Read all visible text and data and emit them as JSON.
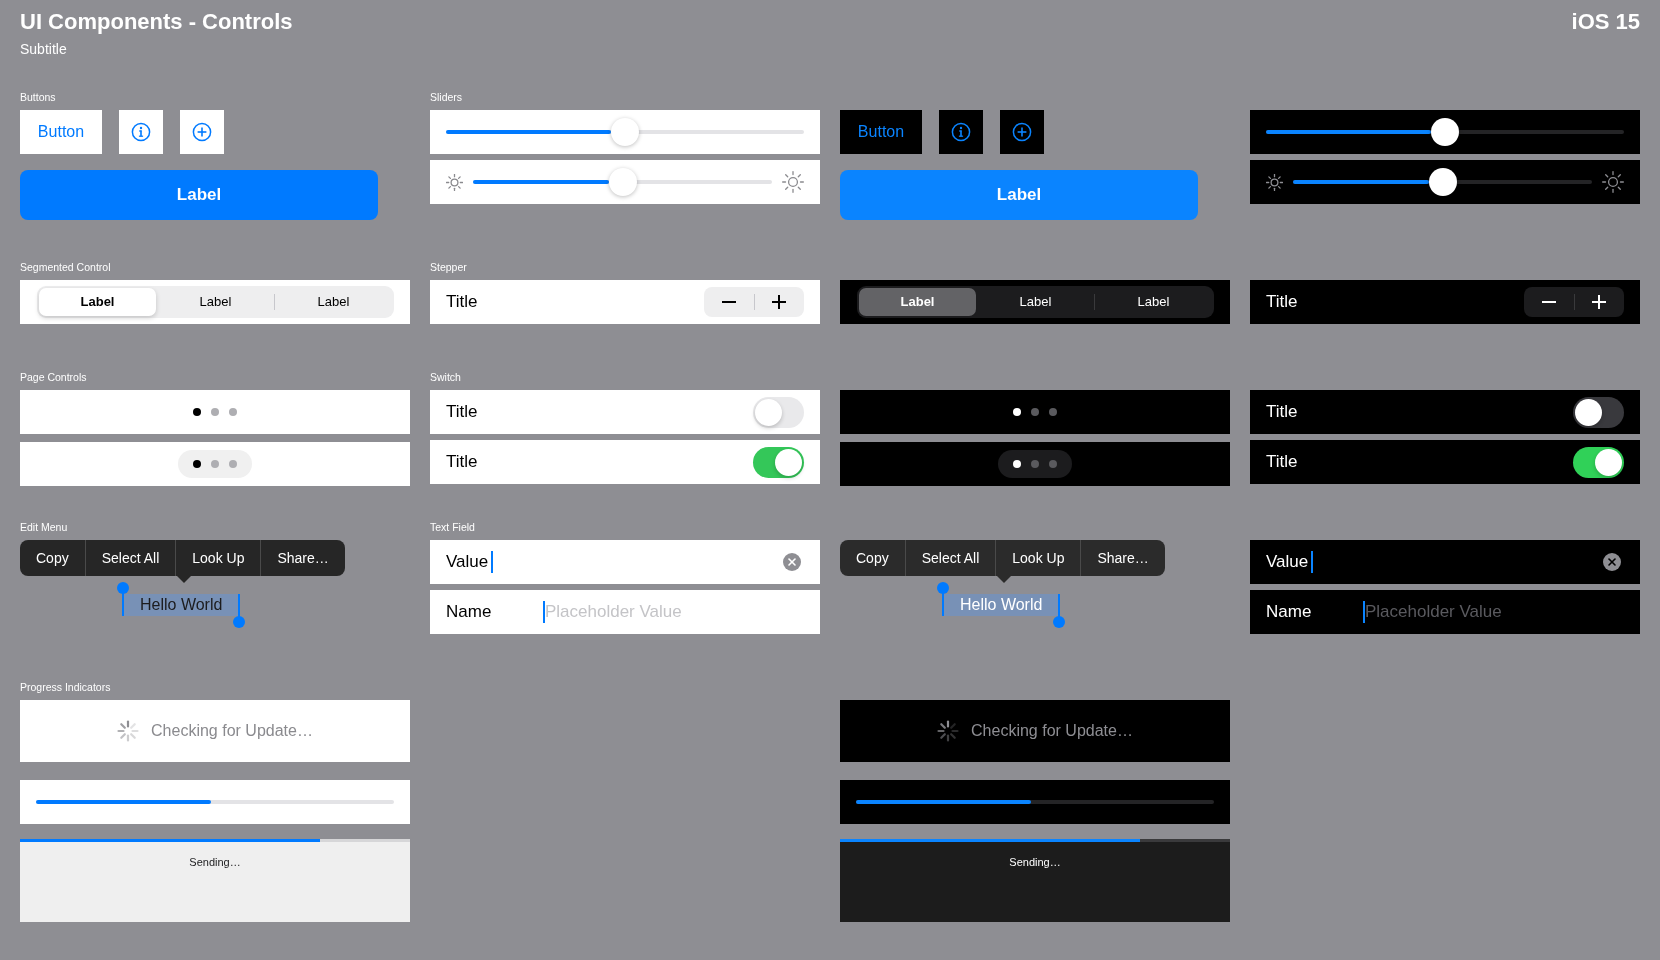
{
  "header": {
    "title": "UI Components - Controls",
    "subtitle": "Subtitle",
    "version": "iOS 15"
  },
  "themes": [
    {
      "kind": "light",
      "sections": [
        {
          "kind": "buttons",
          "label": "Buttons",
          "button": "Button",
          "primary_button": "Label"
        },
        {
          "kind": "sliders",
          "label": "Sliders",
          "sliders": [
            {
              "kind": "plain",
              "level": 0.5
            },
            {
              "kind": "brightness",
              "level": 0.5
            }
          ]
        },
        {
          "kind": "segmented_control",
          "label": "Segmented Control",
          "segments": [
            {
              "label": "Label",
              "selected": true
            },
            {
              "label": "Label",
              "selected": false
            },
            {
              "label": "Label",
              "selected": false
            }
          ]
        },
        {
          "kind": "stepper",
          "label": "Stepper",
          "title": "Title"
        },
        {
          "kind": "page_controls",
          "label": "Page Controls",
          "controls": [
            {
              "kind": "plain",
              "dots": [
                {
                  "selected": true
                },
                {
                  "selected": false
                },
                {
                  "selected": false
                }
              ]
            },
            {
              "kind": "capsule",
              "dots": [
                {
                  "selected": true
                },
                {
                  "selected": false
                },
                {
                  "selected": false
                }
              ]
            }
          ]
        },
        {
          "kind": "switches",
          "label": "Switch",
          "rows": [
            {
              "title": "Title",
              "on": false
            },
            {
              "title": "Title",
              "on": true
            }
          ]
        },
        {
          "kind": "edit_menu",
          "label": "Edit Menu",
          "items": [
            "Copy",
            "Select All",
            "Look Up",
            "Share…"
          ],
          "selected_text": "Hello World"
        },
        {
          "kind": "text_fields",
          "label": "Text Field",
          "fields": [
            {
              "kind": "filled",
              "value": "Value"
            },
            {
              "kind": "labeled",
              "label": "Name",
              "placeholder": "Placeholder Value"
            }
          ]
        },
        {
          "kind": "progress",
          "label": "Progress Indicators",
          "items": [
            {
              "kind": "spinner",
              "label": "Checking for Update…"
            },
            {
              "kind": "bar",
              "level": 0.49
            },
            {
              "kind": "navigation_bar",
              "label": "Sending…",
              "level": 0.77
            }
          ]
        }
      ]
    },
    {
      "kind": "dark",
      "sections": [
        {
          "kind": "buttons",
          "button": "Button",
          "primary_button": "Label"
        },
        {
          "kind": "sliders",
          "sliders": [
            {
              "kind": "plain",
              "level": 0.5
            },
            {
              "kind": "brightness",
              "level": 0.5
            }
          ]
        },
        {
          "kind": "segmented_control",
          "segments": [
            {
              "label": "Label",
              "selected": true
            },
            {
              "label": "Label",
              "selected": false
            },
            {
              "label": "Label",
              "selected": false
            }
          ]
        },
        {
          "kind": "stepper",
          "title": "Title"
        },
        {
          "kind": "page_controls",
          "controls": [
            {
              "kind": "plain",
              "dots": [
                {
                  "selected": true
                },
                {
                  "selected": false
                },
                {
                  "selected": false
                }
              ]
            },
            {
              "kind": "capsule",
              "dots": [
                {
                  "selected": true
                },
                {
                  "selected": false
                },
                {
                  "selected": false
                }
              ]
            }
          ]
        },
        {
          "kind": "switches",
          "rows": [
            {
              "title": "Title",
              "on": false
            },
            {
              "title": "Title",
              "on": true
            }
          ]
        },
        {
          "kind": "edit_menu",
          "items": [
            "Copy",
            "Select All",
            "Look Up",
            "Share…"
          ],
          "selected_text": "Hello World"
        },
        {
          "kind": "text_fields",
          "fields": [
            {
              "kind": "filled",
              "value": "Value"
            },
            {
              "kind": "labeled",
              "label": "Name",
              "placeholder": "Placeholder Value"
            }
          ]
        },
        {
          "kind": "progress",
          "items": [
            {
              "kind": "spinner",
              "label": "Checking for Update…"
            },
            {
              "kind": "bar",
              "level": 0.49
            },
            {
              "kind": "navigation_bar",
              "label": "Sending…",
              "level": 0.77
            }
          ]
        }
      ]
    }
  ]
}
